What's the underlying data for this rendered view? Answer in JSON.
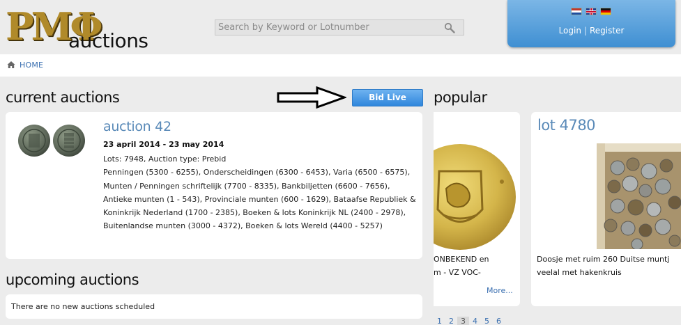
{
  "header": {
    "logo_text": "auctions",
    "search": {
      "placeholder": "Search by Keyword or Lotnumber"
    },
    "account": {
      "login_label": "Login",
      "separator": "|",
      "register_label": "Register"
    }
  },
  "breadcrumb": {
    "home_label": "HOME"
  },
  "current": {
    "title": "current auctions",
    "bid_live_label": "Bid Live",
    "auction": {
      "title": "auction 42",
      "dates": "23 april 2014 - 23 may 2014",
      "lots_line": "Lots: 7948, Auction type: Prebid",
      "categories": "Penningen (5300 - 6255), Onderscheidingen (6300 - 6453), Varia (6500 - 6575), Munten / Penningen schriftelijk (7700 - 8335), Bankbiljetten (6600 - 7656), Antieke munten (1 - 543), Provinciale munten (600 - 1629), Bataafse Republiek & Koninkrijk Nederland (1700 - 2385), Boeken & lots Koninkrijk NL (2400 - 2978), Buitenlandse munten (3000 - 4372), Boeken & lots Wereld (4400 - 5257)"
    }
  },
  "upcoming": {
    "title": "upcoming auctions",
    "empty_text": "There are no new auctions scheduled"
  },
  "popular": {
    "title": "popular",
    "card1": {
      "text_line1": "ONBEKEND en",
      "text_line2": "m - VZ VOC-",
      "more_label": "More..."
    },
    "card2": {
      "title": "lot 4780",
      "text_line1": "Doosje met ruim 260 Duitse muntj",
      "text_line2": "veelal met hakenkruis"
    },
    "pages": [
      "1",
      "2",
      "3",
      "4",
      "5",
      "6"
    ],
    "active_page": "3"
  },
  "colors": {
    "accent_blue": "#3f8fd2",
    "link_blue": "#3a6fb0",
    "title_blue": "#5a8ab8",
    "logo_gold": "#b08a2a"
  },
  "icons": {
    "search": "search-icon",
    "home": "home-icon",
    "arrow": "arrow-right-icon"
  }
}
